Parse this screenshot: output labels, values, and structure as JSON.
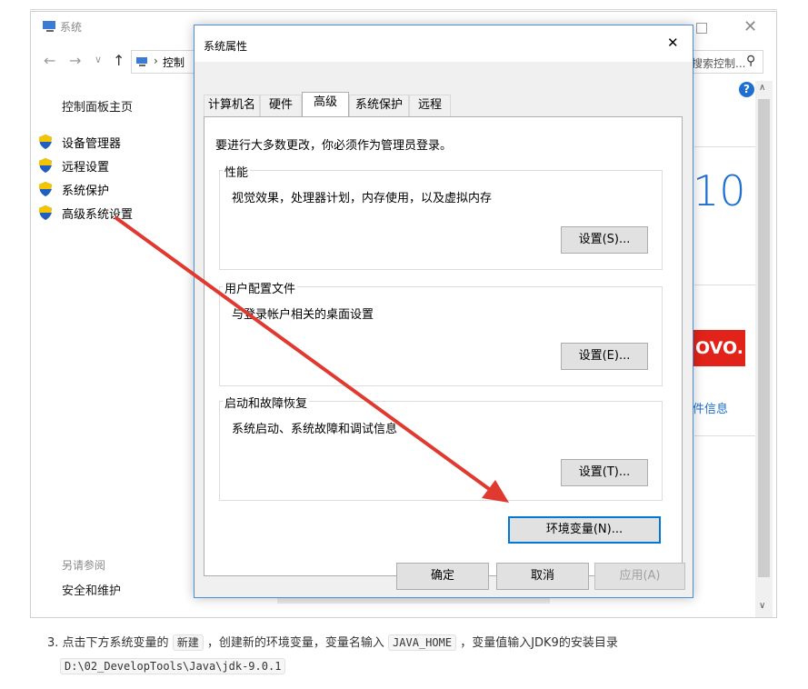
{
  "window": {
    "title": "系统",
    "breadcrumb": "控制",
    "search_placeholder": "搜索控制...",
    "right_partial_10": "10",
    "right_partial_info": "件信息",
    "brand": "OVO."
  },
  "sidebar": {
    "home": "控制面板主页",
    "items": [
      {
        "label": "设备管理器"
      },
      {
        "label": "远程设置"
      },
      {
        "label": "系统保护"
      },
      {
        "label": "高级系统设置"
      }
    ],
    "see_also": "另请参阅",
    "security": "安全和维护"
  },
  "dialog": {
    "title": "系统属性",
    "tabs": [
      "计算机名",
      "硬件",
      "高级",
      "系统保护",
      "远程"
    ],
    "admin_note": "要进行大多数更改，你必须作为管理员登录。",
    "performance": {
      "title": "性能",
      "desc": "视觉效果，处理器计划，内存使用，以及虚拟内存",
      "button": "设置(S)..."
    },
    "profiles": {
      "title": "用户配置文件",
      "desc": "与登录帐户相关的桌面设置",
      "button": "设置(E)..."
    },
    "startup": {
      "title": "启动和故障恢复",
      "desc": "系统启动、系统故障和调试信息",
      "button": "设置(T)..."
    },
    "env_button": "环境变量(N)...",
    "ok": "确定",
    "cancel": "取消",
    "apply": "应用(A)"
  },
  "instruction": {
    "number": "3.",
    "part1": "点击下方系统变量的",
    "code1": "新建",
    "part2": "，创建新的环境变量，变量名输入",
    "code2": "JAVA_HOME",
    "part3": "，变量值输入JDK9的安装目录",
    "code3": "D:\\02_DevelopTools\\Java\\jdk-9.0.1"
  },
  "colors": {
    "accent": "#0078d7",
    "arrow": "#e03a30",
    "lenovo": "#e2231a",
    "help": "#1e6fd1"
  }
}
